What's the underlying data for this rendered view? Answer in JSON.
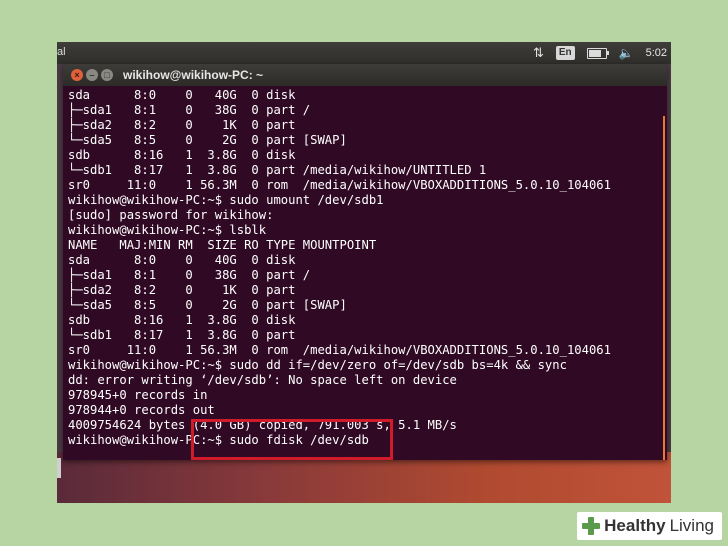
{
  "topbar": {
    "app_fragment": "al",
    "lang": "En",
    "clock": "5:02",
    "battery_level": 0.8
  },
  "window": {
    "title": "wikihow@wikihow-PC: ~",
    "close_glyph": "×",
    "min_glyph": "–",
    "max_glyph": "□"
  },
  "terminal_lines": [
    "sda      8:0    0   40G  0 disk",
    "├─sda1   8:1    0   38G  0 part /",
    "├─sda2   8:2    0    1K  0 part",
    "└─sda5   8:5    0    2G  0 part [SWAP]",
    "sdb      8:16   1  3.8G  0 disk",
    "└─sdb1   8:17   1  3.8G  0 part /media/wikihow/UNTITLED 1",
    "sr0     11:0    1 56.3M  0 rom  /media/wikihow/VBOXADDITIONS_5.0.10_104061",
    "wikihow@wikihow-PC:~$ sudo umount /dev/sdb1",
    "[sudo] password for wikihow:",
    "wikihow@wikihow-PC:~$ lsblk",
    "NAME   MAJ:MIN RM  SIZE RO TYPE MOUNTPOINT",
    "sda      8:0    0   40G  0 disk",
    "├─sda1   8:1    0   38G  0 part /",
    "├─sda2   8:2    0    1K  0 part",
    "└─sda5   8:5    0    2G  0 part [SWAP]",
    "sdb      8:16   1  3.8G  0 disk",
    "└─sdb1   8:17   1  3.8G  0 part",
    "sr0     11:0    1 56.3M  0 rom  /media/wikihow/VBOXADDITIONS_5.0.10_104061",
    "wikihow@wikihow-PC:~$ sudo dd if=/dev/zero of=/dev/sdb bs=4k && sync",
    "dd: error writing ‘/dev/sdb’: No space left on device",
    "978945+0 records in",
    "978944+0 records out",
    "4009754624 bytes (4.0 GB) copied, 791.003 s, 5.1 MB/s",
    "wikihow@wikihow-PC:~$ sudo fdisk /dev/sdb"
  ],
  "watermark": {
    "word1": "Healthy",
    "word2": "Living"
  }
}
